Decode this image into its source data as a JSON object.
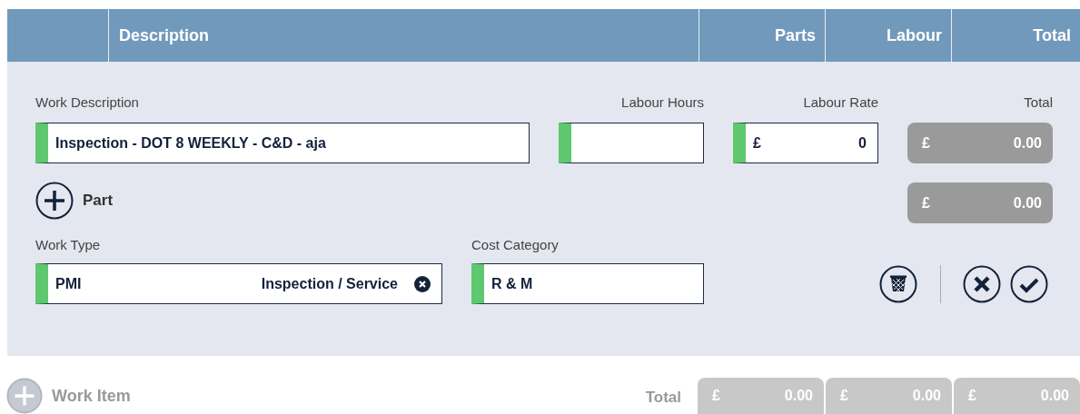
{
  "header": {
    "columns": [
      "Description",
      "Parts",
      "Labour",
      "Total"
    ]
  },
  "form": {
    "work_description": {
      "label": "Work Description",
      "value": "Inspection - DOT 8 WEEKLY - C&D - aja"
    },
    "labour_hours": {
      "label": "Labour Hours"
    },
    "labour_rate": {
      "label": "Labour Rate",
      "currency": "£",
      "value": "0"
    },
    "total": {
      "label": "Total",
      "currency": "£",
      "value": "0.00"
    },
    "add_part": {
      "label": "Part"
    },
    "part_total": {
      "currency": "£",
      "value": "0.00"
    },
    "work_type": {
      "label": "Work Type",
      "code": "PMI",
      "value": "Inspection / Service"
    },
    "cost_category": {
      "label": "Cost Category",
      "value": "R & M"
    }
  },
  "footer": {
    "add_work_item": {
      "label": "Work Item"
    },
    "total_label": "Total",
    "totals": [
      {
        "currency": "£",
        "value": "0.00"
      },
      {
        "currency": "£",
        "value": "0.00"
      },
      {
        "currency": "£",
        "value": "0.00"
      }
    ]
  }
}
